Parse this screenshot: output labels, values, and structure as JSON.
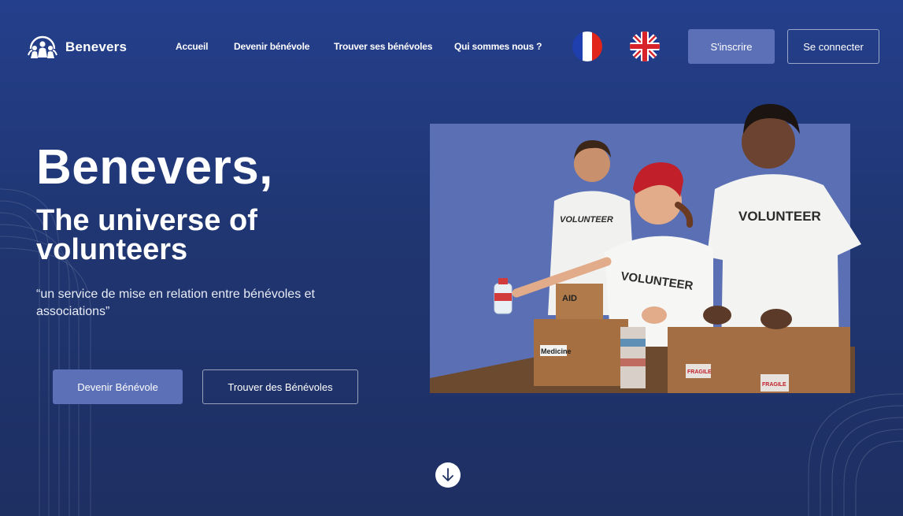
{
  "brand": {
    "name": "Benevers",
    "logo_icon": "people-circle-logo-icon"
  },
  "nav": {
    "links": [
      "Accueil",
      "Devenir bénévole",
      "Trouver ses bénévoles",
      "Qui sommes nous ?"
    ],
    "flags": [
      "france-flag-icon",
      "uk-flag-icon"
    ],
    "signup_label": "S'inscrire",
    "login_label": "Se connecter"
  },
  "hero": {
    "title": "Benevers,",
    "subtitle": "The universe of volunteers",
    "quote": "“un service de mise en relation entre bénévoles et associations”",
    "primary_button": "Devenir Bénévole",
    "secondary_button": "Trouver des Bénévoles",
    "scroll_icon": "arrow-down-icon"
  },
  "image": {
    "shirt_text": "VOLUNTEER",
    "box_labels": [
      "AID",
      "Medicine",
      "FRAGILE",
      "FRAGILE"
    ]
  },
  "colors": {
    "background_top": "#243f8c",
    "background_bottom": "#1e2f62",
    "accent": "#5b70b6",
    "image_panel": "#5a6fb4"
  }
}
